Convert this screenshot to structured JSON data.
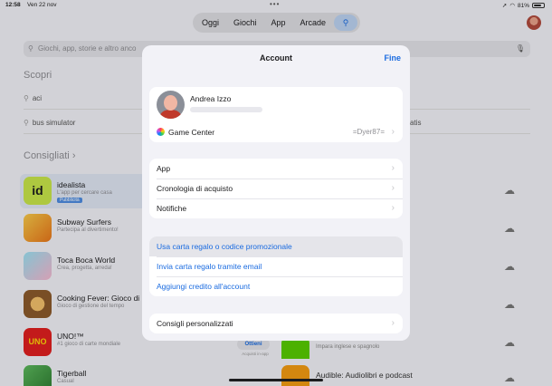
{
  "status": {
    "time": "12:58",
    "date": "Ven 22 nov",
    "dots": "•••",
    "battery": "81%",
    "battery_level": 0.81
  },
  "tabs": [
    {
      "label": "Oggi"
    },
    {
      "label": "Giochi"
    },
    {
      "label": "App"
    },
    {
      "label": "Arcade"
    }
  ],
  "background": {
    "search_placeholder": "Giochi, app, storie e altro anco",
    "discover_title": "Scopri",
    "suggestions": [
      "aci",
      "bus simulator"
    ],
    "partial_right": "atis",
    "recommended_title": "Consigliati",
    "apps": [
      {
        "name": "idealista",
        "subtitle": "L'app per cercare casa",
        "badge": "Pubblicità",
        "color": "#c8e64a"
      },
      {
        "name": "Subway Surfers",
        "subtitle": "Partecipa al divertimento!",
        "color": "#f5a623"
      },
      {
        "name": "Toca Boca World",
        "subtitle": "Crea, progetta, arreda!",
        "color": "#7fd1e8"
      },
      {
        "name": "Cooking Fever: Gioco di",
        "subtitle": "Gioco di gestione del tempo",
        "color": "#8b5a2b"
      },
      {
        "name": "UNO!™",
        "subtitle": "#1 gioco di carte mondiale",
        "color": "#e02020"
      },
      {
        "name": "Tigerball",
        "subtitle": "Casual",
        "color": "#44a047"
      }
    ],
    "right_apps": [
      {
        "name": "Impara inglese e spagnolo"
      },
      {
        "name": "Audible: Audiolibri e podcast"
      }
    ],
    "get_button": "Ottieni",
    "get_sub": "Acquisti in-app"
  },
  "modal": {
    "title": "Account",
    "done": "Fine",
    "profile": {
      "name": "Andrea Izzo"
    },
    "game_center": {
      "label": "Game Center",
      "value": "=Dyer87="
    },
    "group2": [
      "App",
      "Cronologia di acquisto",
      "Notifiche"
    ],
    "group3": [
      "Usa carta regalo o codice promozionale",
      "Invia carta regalo tramite email",
      "Aggiungi credito all'account"
    ],
    "group4": [
      "Consigli personalizzati"
    ]
  }
}
